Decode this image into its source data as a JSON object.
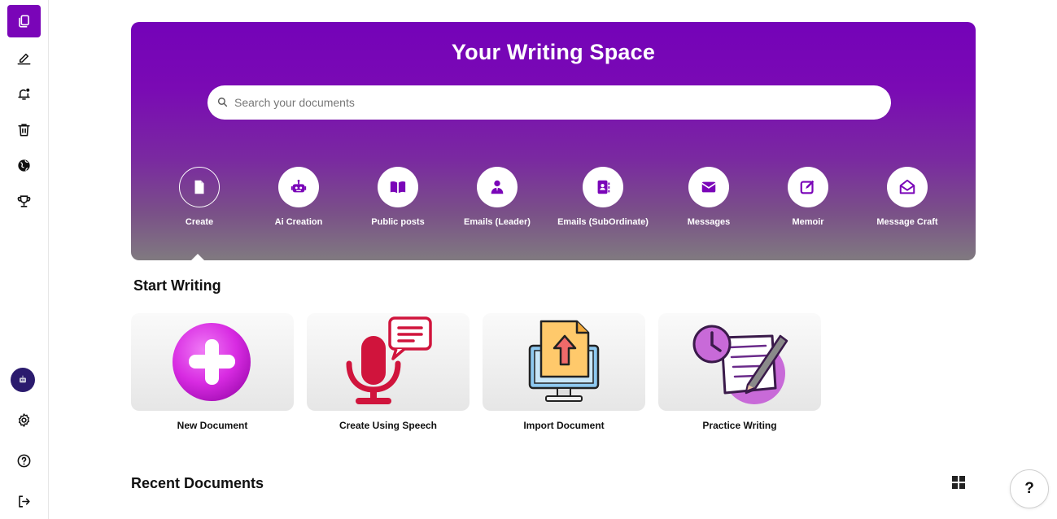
{
  "hero": {
    "title": "Your Writing Space",
    "search_placeholder": "Search your documents",
    "tools": [
      {
        "label": "Create",
        "icon": "file-icon"
      },
      {
        "label": "Ai Creation",
        "icon": "robot-icon"
      },
      {
        "label": "Public posts",
        "icon": "book-open-icon"
      },
      {
        "label": "Emails (Leader)",
        "icon": "user-tie-icon"
      },
      {
        "label": "Emails (SubOrdinate)",
        "icon": "address-book-icon"
      },
      {
        "label": "Messages",
        "icon": "envelope-icon"
      },
      {
        "label": "Memoir",
        "icon": "pen-square-icon"
      },
      {
        "label": "Message Craft",
        "icon": "envelope-open-icon"
      }
    ]
  },
  "start_writing": {
    "title": "Start Writing",
    "cards": [
      {
        "label": "New Document",
        "icon": "plus-circle-icon"
      },
      {
        "label": "Create Using Speech",
        "icon": "microphone-chat-icon"
      },
      {
        "label": "Import Document",
        "icon": "import-monitor-icon"
      },
      {
        "label": "Practice Writing",
        "icon": "clock-notepad-pen-icon"
      }
    ]
  },
  "recent": {
    "title": "Recent Documents"
  },
  "help_label": "?",
  "colors": {
    "accent": "#7a05b8",
    "hero_top": "#7402b8",
    "hero_bottom": "#807a80",
    "speech_red": "#d0143c"
  }
}
